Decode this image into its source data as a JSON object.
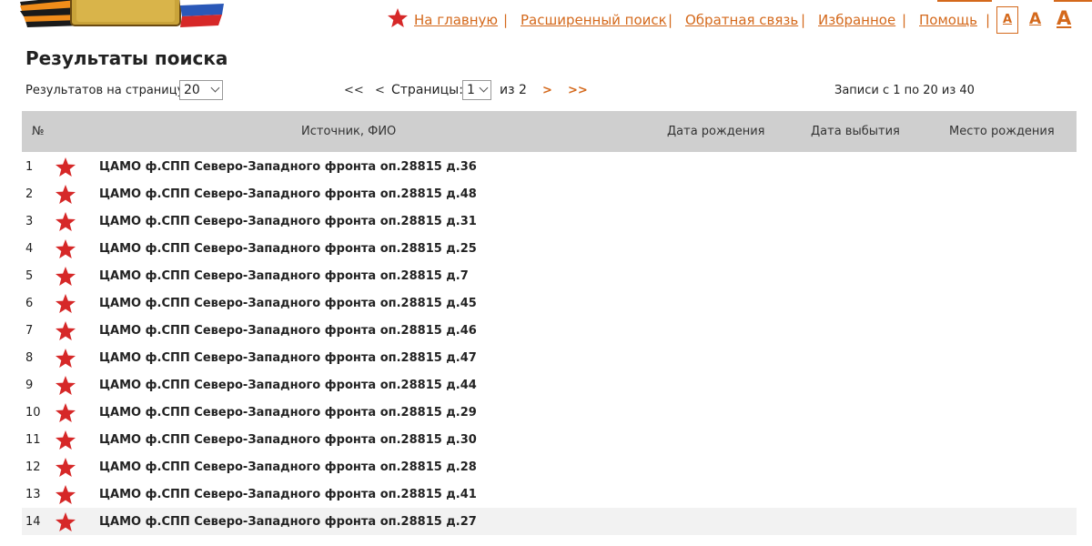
{
  "header": {
    "nav": [
      {
        "label": "На главную"
      },
      {
        "label": "Расширенный поиск"
      },
      {
        "label": "Обратная связь"
      },
      {
        "label": "Избранное"
      },
      {
        "label": "Помощь"
      }
    ],
    "separator": "|",
    "font_sizes": [
      "A",
      "A",
      "A"
    ]
  },
  "page_title": "Результаты поиска",
  "controls": {
    "per_page_label": "Результатов на страницу:",
    "per_page_value": "20",
    "first": "<<",
    "prev": "<",
    "pages_label": "Страницы:",
    "page_value": "1",
    "of_label": "из 2",
    "next": ">",
    "last": ">>",
    "records_info": "Записи с 1 по 20 из 40"
  },
  "table": {
    "headers": {
      "num": "№",
      "source": "Источник, ФИО",
      "birth_date": "Дата рождения",
      "retire_date": "Дата выбытия",
      "birth_place": "Место рождения"
    },
    "rows": [
      {
        "num": "1",
        "source": "ЦАМО ф.СПП Северо-Западного фронта оп.28815 д.36"
      },
      {
        "num": "2",
        "source": "ЦАМО ф.СПП Северо-Западного фронта оп.28815 д.48"
      },
      {
        "num": "3",
        "source": "ЦАМО ф.СПП Северо-Западного фронта оп.28815 д.31"
      },
      {
        "num": "4",
        "source": "ЦАМО ф.СПП Северо-Западного фронта оп.28815 д.25"
      },
      {
        "num": "5",
        "source": "ЦАМО ф.СПП Северо-Западного фронта оп.28815 д.7"
      },
      {
        "num": "6",
        "source": "ЦАМО ф.СПП Северо-Западного фронта оп.28815 д.45"
      },
      {
        "num": "7",
        "source": "ЦАМО ф.СПП Северо-Западного фронта оп.28815 д.46"
      },
      {
        "num": "8",
        "source": "ЦАМО ф.СПП Северо-Западного фронта оп.28815 д.47"
      },
      {
        "num": "9",
        "source": "ЦАМО ф.СПП Северо-Западного фронта оп.28815 д.44"
      },
      {
        "num": "10",
        "source": "ЦАМО ф.СПП Северо-Западного фронта оп.28815 д.29"
      },
      {
        "num": "11",
        "source": "ЦАМО ф.СПП Северо-Западного фронта оп.28815 д.30"
      },
      {
        "num": "12",
        "source": "ЦАМО ф.СПП Северо-Западного фронта оп.28815 д.28"
      },
      {
        "num": "13",
        "source": "ЦАМО ф.СПП Северо-Западного фронта оп.28815 д.41"
      },
      {
        "num": "14",
        "source": "ЦАМО ф.СПП Северо-Западного фронта оп.28815 д.27"
      }
    ]
  },
  "colors": {
    "accent": "#d4691c",
    "star": "#d62828",
    "header_bg": "#cfcfcf"
  },
  "icons": {
    "star": "star-icon",
    "logo": "logo-icon"
  }
}
